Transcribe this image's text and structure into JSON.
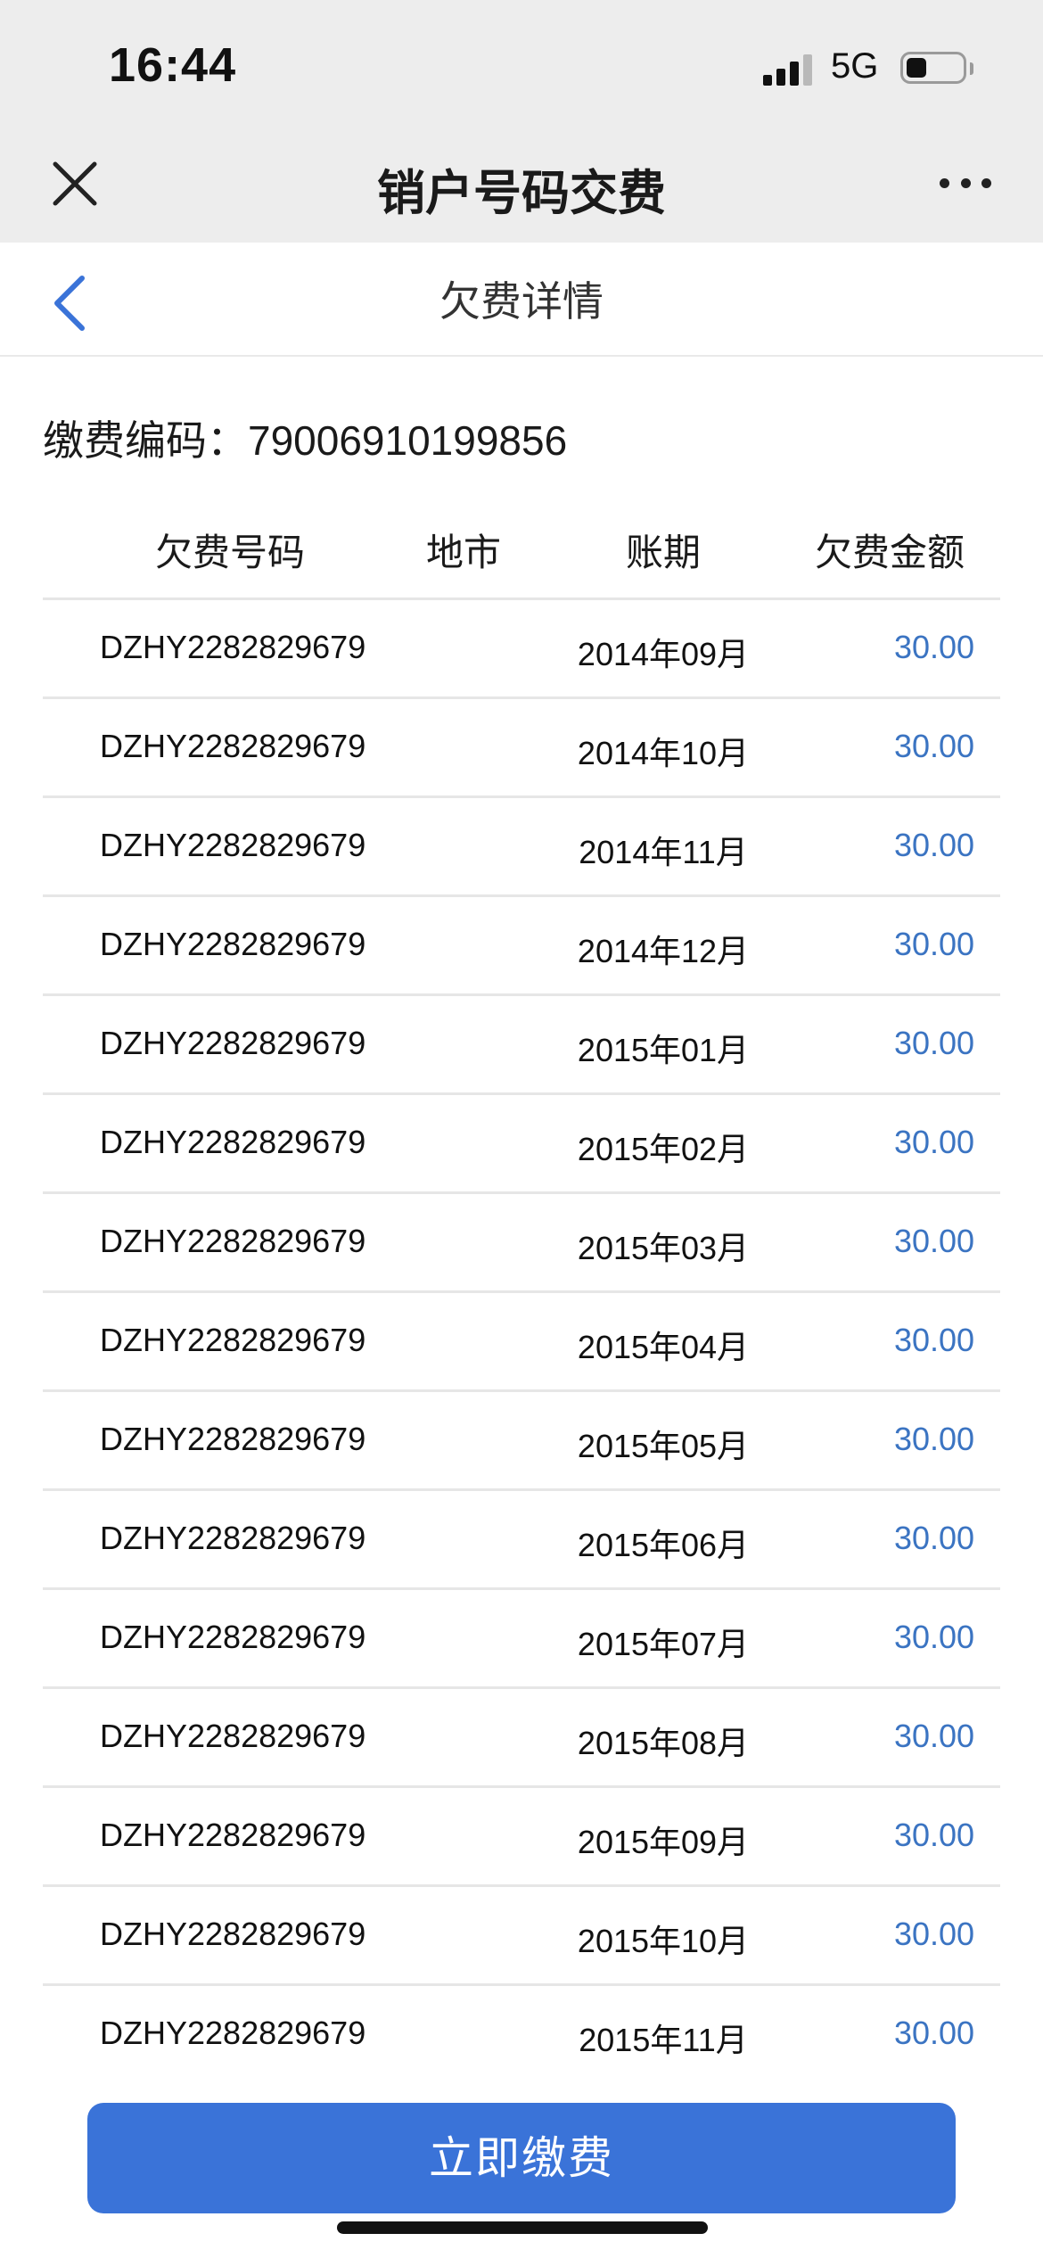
{
  "status_bar": {
    "time": "16:44",
    "network": "5G"
  },
  "nav": {
    "title": "销户号码交费"
  },
  "sub_header": {
    "title": "欠费详情"
  },
  "payment_code": {
    "label": "缴费编码：",
    "value": "79006910199856"
  },
  "table": {
    "headers": [
      "欠费号码",
      "地市",
      "账期",
      "欠费金额"
    ],
    "rows": [
      {
        "number": "DZHY2282829679",
        "city": "",
        "period": "2014年09月",
        "amount": "30.00"
      },
      {
        "number": "DZHY2282829679",
        "city": "",
        "period": "2014年10月",
        "amount": "30.00"
      },
      {
        "number": "DZHY2282829679",
        "city": "",
        "period": "2014年11月",
        "amount": "30.00"
      },
      {
        "number": "DZHY2282829679",
        "city": "",
        "period": "2014年12月",
        "amount": "30.00"
      },
      {
        "number": "DZHY2282829679",
        "city": "",
        "period": "2015年01月",
        "amount": "30.00"
      },
      {
        "number": "DZHY2282829679",
        "city": "",
        "period": "2015年02月",
        "amount": "30.00"
      },
      {
        "number": "DZHY2282829679",
        "city": "",
        "period": "2015年03月",
        "amount": "30.00"
      },
      {
        "number": "DZHY2282829679",
        "city": "",
        "period": "2015年04月",
        "amount": "30.00"
      },
      {
        "number": "DZHY2282829679",
        "city": "",
        "period": "2015年05月",
        "amount": "30.00"
      },
      {
        "number": "DZHY2282829679",
        "city": "",
        "period": "2015年06月",
        "amount": "30.00"
      },
      {
        "number": "DZHY2282829679",
        "city": "",
        "period": "2015年07月",
        "amount": "30.00"
      },
      {
        "number": "DZHY2282829679",
        "city": "",
        "period": "2015年08月",
        "amount": "30.00"
      },
      {
        "number": "DZHY2282829679",
        "city": "",
        "period": "2015年09月",
        "amount": "30.00"
      },
      {
        "number": "DZHY2282829679",
        "city": "",
        "period": "2015年10月",
        "amount": "30.00"
      },
      {
        "number": "DZHY2282829679",
        "city": "",
        "period": "2015年11月",
        "amount": "30.00"
      }
    ]
  },
  "actions": {
    "pay_now": "立即缴费"
  },
  "colors": {
    "accent": "#3a73d8",
    "amount": "#3b74c2",
    "header_bg": "#ededed"
  },
  "icons": [
    "close-icon",
    "more-icon",
    "back-icon",
    "signal-icon",
    "battery-icon"
  ]
}
